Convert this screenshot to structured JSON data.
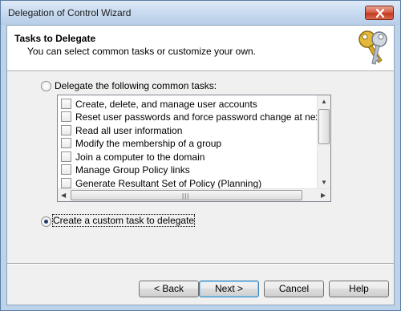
{
  "window": {
    "title": "Delegation of Control Wizard"
  },
  "header": {
    "title": "Tasks to Delegate",
    "subtitle": "You can select common tasks or customize your own."
  },
  "options": {
    "common_tasks_label": "Delegate the following common tasks:",
    "common_tasks_selected": false,
    "custom_task_label": "Create a custom task to delegate",
    "custom_task_selected": true
  },
  "tasks": [
    {
      "label": "Create, delete, and manage user accounts",
      "checked": false
    },
    {
      "label": "Reset user passwords and force password change at next logon",
      "checked": false
    },
    {
      "label": "Read all user information",
      "checked": false
    },
    {
      "label": "Modify the membership of a group",
      "checked": false
    },
    {
      "label": "Join a computer to the domain",
      "checked": false
    },
    {
      "label": "Manage Group Policy links",
      "checked": false
    },
    {
      "label": "Generate Resultant Set of Policy (Planning)",
      "checked": false
    }
  ],
  "buttons": {
    "back": "< Back",
    "next": "Next >",
    "cancel": "Cancel",
    "help": "Help"
  },
  "icons": {
    "header": "keys-icon",
    "close": "close-icon"
  }
}
